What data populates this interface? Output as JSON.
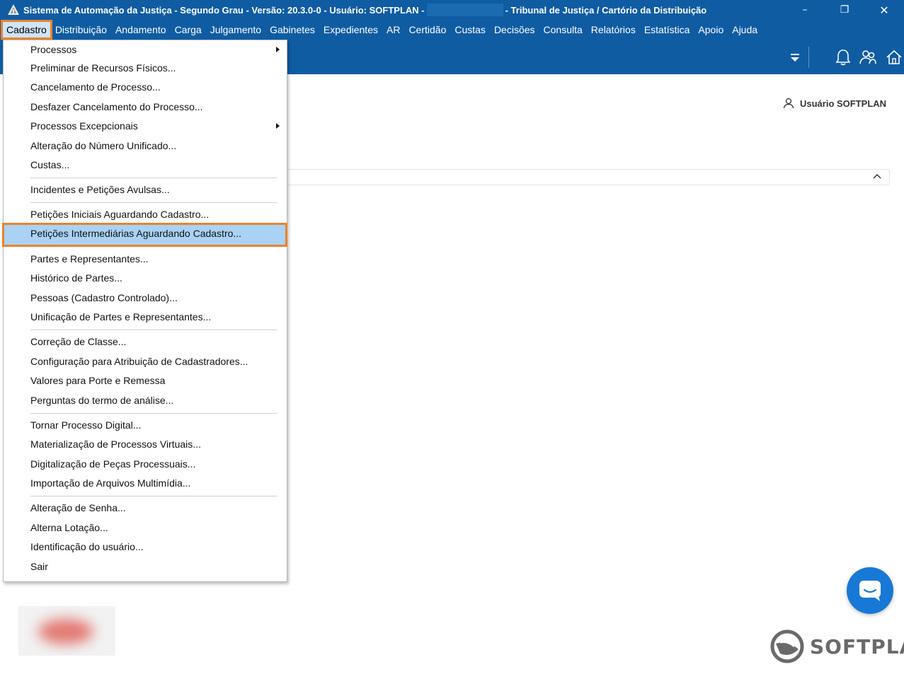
{
  "window": {
    "title_left": "Sistema de Automação da Justiça - Segundo Grau - Versão: 20.3.0-0 - Usuário: SOFTPLAN -",
    "title_right": "- Tribunal de Justiça / Cartório da Distribuição",
    "controls": {
      "minimize": "–",
      "restore": "❐",
      "close": "✕"
    }
  },
  "menubar": {
    "items": [
      "Cadastro",
      "Distribuição",
      "Andamento",
      "Carga",
      "Julgamento",
      "Gabinetes",
      "Expedientes",
      "AR",
      "Certidão",
      "Custas",
      "Decisões",
      "Consulta",
      "Relatórios",
      "Estatística",
      "Apoio",
      "Ajuda"
    ],
    "active": "Cadastro"
  },
  "toolbar": {
    "icons": [
      "filter-dropdown-icon",
      "bell-icon",
      "users-icon",
      "home-icon"
    ]
  },
  "content": {
    "user_label": "Usuário SOFTPLAN"
  },
  "brand": {
    "text": "SOFTPLAN"
  },
  "dropdown": {
    "items": [
      {
        "label": "Processos",
        "submenu": true
      },
      {
        "label": "Preliminar de Recursos Físicos...",
        "submenu": false
      },
      {
        "label": "Cancelamento de Processo...",
        "submenu": false
      },
      {
        "label": "Desfazer Cancelamento do Processo...",
        "submenu": false
      },
      {
        "label": "Processos Excepcionais",
        "submenu": true
      },
      {
        "label": "Alteração do Número Unificado...",
        "submenu": false
      },
      {
        "label": "Custas...",
        "submenu": false
      },
      {
        "label": "Incidentes e Petições Avulsas...",
        "submenu": false
      },
      {
        "label": "Petições Iniciais Aguardando Cadastro...",
        "submenu": false
      },
      {
        "label": "Petições Intermediárias Aguardando Cadastro...",
        "submenu": false,
        "highlighted": true
      },
      {
        "label": "Partes e Representantes...",
        "submenu": false
      },
      {
        "label": "Histórico de Partes...",
        "submenu": false
      },
      {
        "label": "Pessoas (Cadastro Controlado)...",
        "submenu": false
      },
      {
        "label": "Unificação de Partes e Representantes...",
        "submenu": false
      },
      {
        "label": "Correção de Classe...",
        "submenu": false
      },
      {
        "label": "Configuração para Atribuição de Cadastradores...",
        "submenu": false
      },
      {
        "label": "Valores para Porte e Remessa",
        "submenu": false
      },
      {
        "label": "Perguntas do termo de análise...",
        "submenu": false
      },
      {
        "label": "Tornar Processo Digital...",
        "submenu": false
      },
      {
        "label": "Materialização de Processos Virtuais...",
        "submenu": false
      },
      {
        "label": "Digitalização de Peças Processuais...",
        "submenu": false
      },
      {
        "label": "Importação de Arquivos Multimídia...",
        "submenu": false
      },
      {
        "label": "Alteração de Senha...",
        "submenu": false
      },
      {
        "label": "Alterna Lotação...",
        "submenu": false
      },
      {
        "label": "Identificação do usuário...",
        "submenu": false
      },
      {
        "label": "Sair",
        "submenu": false
      }
    ]
  }
}
